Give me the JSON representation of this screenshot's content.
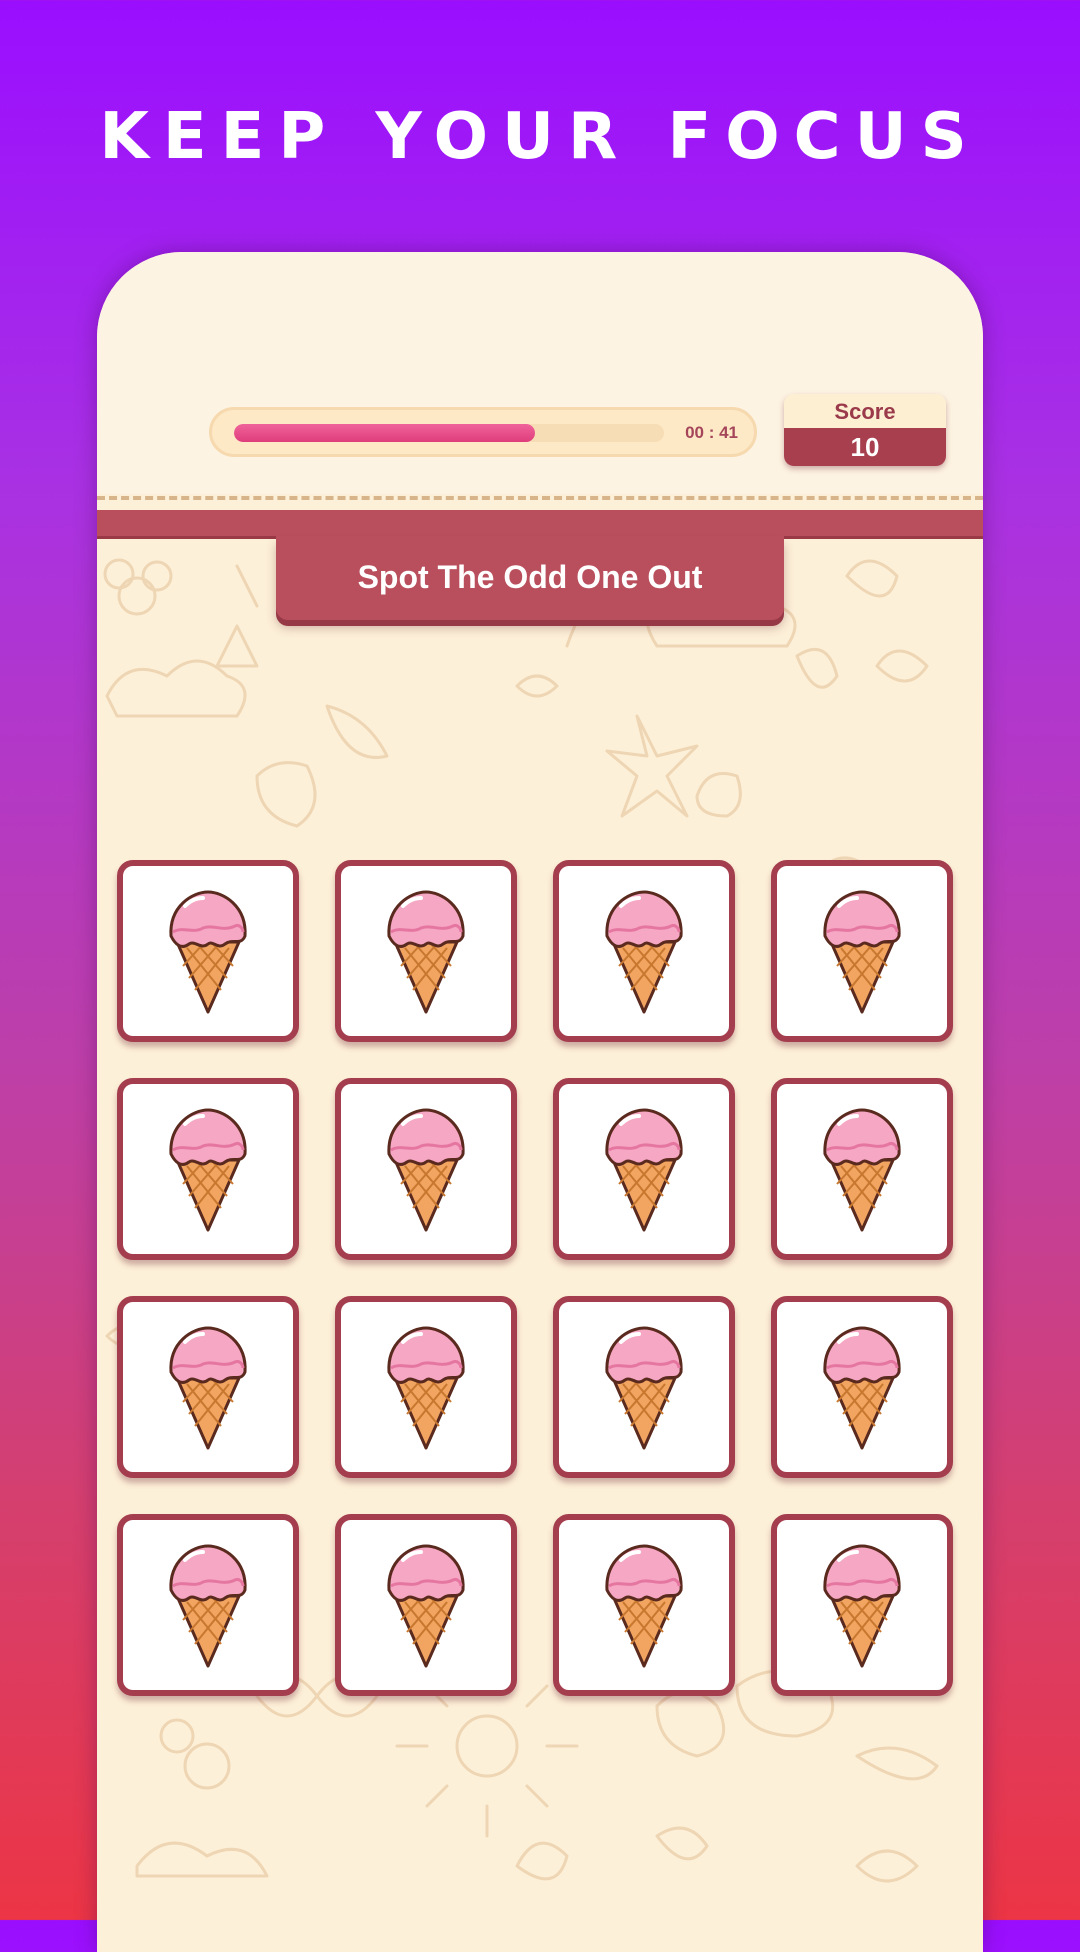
{
  "headline": "KEEP YOUR FOCUS",
  "timer": {
    "progress": 0.7,
    "time_text": "00 : 41"
  },
  "score": {
    "label": "Score",
    "value": "10"
  },
  "banner": {
    "text": "Spot The Odd One Out"
  },
  "grid": {
    "rows": 4,
    "cols": 4,
    "item_icon": "ice-cream-cone-icon"
  },
  "colors": {
    "accent": "#b94f5c",
    "tile_border": "#a43e4e",
    "progress": "#df3d7c",
    "background_top": "#9a0eff",
    "background_bottom": "#ec3545"
  }
}
